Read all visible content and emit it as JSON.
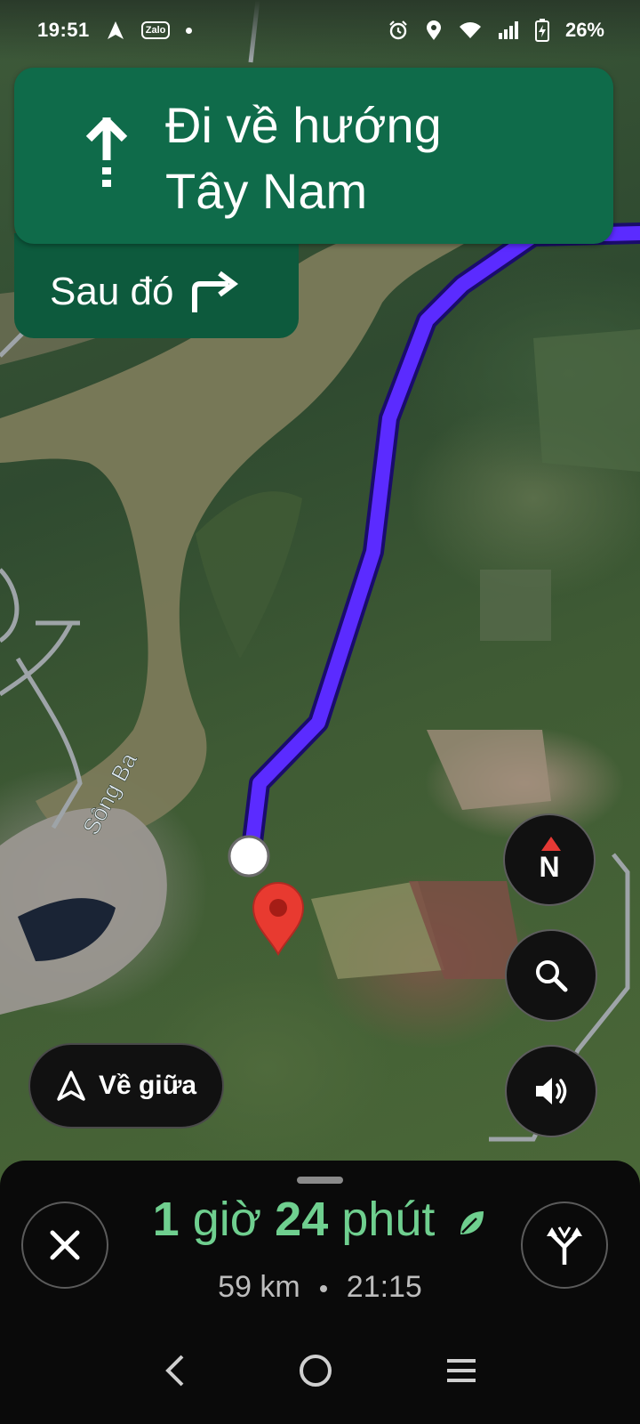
{
  "status_bar": {
    "time": "19:51",
    "app_badge": "Zalo",
    "battery_percent": "26%"
  },
  "navigation": {
    "instruction_line1": "Đi về hướng",
    "instruction_line2": "Tây Nam",
    "then_label": "Sau đó"
  },
  "map": {
    "river_label": "Sông Ba",
    "route_color": "#5b2bff",
    "compass_label": "N"
  },
  "controls": {
    "recenter_label": "Về giữa"
  },
  "trip": {
    "duration_hours_value": "1",
    "duration_hours_unit": "giờ",
    "duration_minutes_value": "24",
    "duration_minutes_unit": "phút",
    "distance": "59 km",
    "arrival_time": "21:15"
  },
  "icons": [
    "navigation-arrow-icon",
    "alarm-icon",
    "location-icon",
    "wifi-icon",
    "signal-icon",
    "battery-charging-icon",
    "straight-arrow-icon",
    "turn-right-icon",
    "compass-icon",
    "search-icon",
    "sound-icon",
    "close-icon",
    "alternate-routes-icon",
    "eco-leaf-icon",
    "back-icon",
    "home-icon",
    "recents-icon"
  ]
}
